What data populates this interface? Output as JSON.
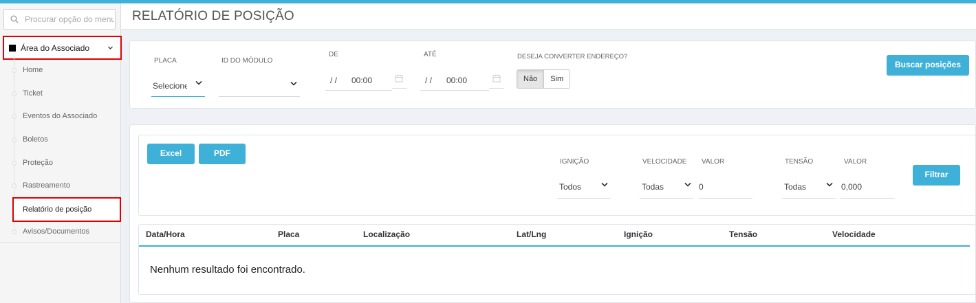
{
  "sidebar": {
    "search_placeholder": "Procurar opção do menu",
    "group_label": "Área do Associado",
    "items": [
      {
        "label": "Home"
      },
      {
        "label": "Ticket"
      },
      {
        "label": "Eventos do Associado"
      },
      {
        "label": "Boletos"
      },
      {
        "label": "Proteção"
      },
      {
        "label": "Rastreamento"
      },
      {
        "label": "Relatório de posição",
        "active": true
      },
      {
        "label": "Avisos/Documentos"
      }
    ]
  },
  "page": {
    "title": "RELATÓRIO DE POSIÇÃO"
  },
  "filters": {
    "placa_label": "PLACA",
    "placa_value": "Selecione",
    "modulo_label": "ID DO MÓDULO",
    "modulo_value": "",
    "de_label": "DE",
    "de_date": "/ /",
    "de_time": "00:00",
    "ate_label": "ATÉ",
    "ate_date": "/ /",
    "ate_time": "00:00",
    "converter_label": "DESEJA CONVERTER ENDEREÇO?",
    "converter_options": [
      "Não",
      "Sim"
    ],
    "converter_selected": "Não",
    "search_button": "Buscar posições"
  },
  "results_filters": {
    "excel_button": "Excel",
    "pdf_button": "PDF",
    "ignicao_label": "IGNIÇÃO",
    "ignicao_value": "Todos",
    "velocidade_label": "VELOCIDADE",
    "velocidade_value": "Todas",
    "velocidade_valor_label": "VALOR",
    "velocidade_valor": "0",
    "tensao_label": "TENSÃO",
    "tensao_value": "Todas",
    "tensao_valor_label": "VALOR",
    "tensao_valor": "0,000",
    "filter_button": "Filtrar"
  },
  "table": {
    "columns": [
      "Data/Hora",
      "Placa",
      "Localização",
      "Lat/Lng",
      "Ignição",
      "Tensão",
      "Velocidade"
    ],
    "empty_message": "Nenhum resultado foi encontrado."
  },
  "colors": {
    "accent": "#3fb0d8",
    "highlight_border": "#e00000"
  },
  "icons": [
    "search-icon",
    "chevron-down-icon",
    "calendar-icon"
  ]
}
